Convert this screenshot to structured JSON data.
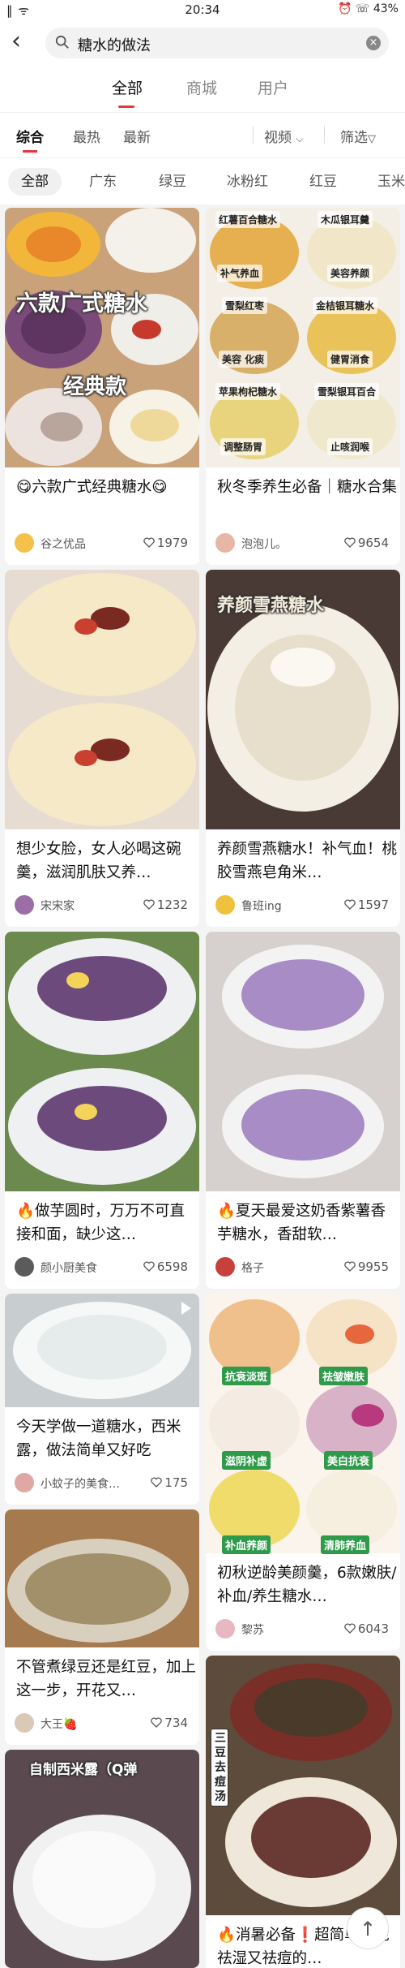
{
  "status": {
    "signal": "‖ ᯤ",
    "time": "20:34",
    "right": "⏰ ☏ 43%"
  },
  "search": {
    "query": "糖水的做法"
  },
  "tabs": [
    {
      "label": "全部"
    },
    {
      "label": "商城"
    },
    {
      "label": "用户"
    }
  ],
  "sort": {
    "items": [
      {
        "label": "综合"
      },
      {
        "label": "最热"
      },
      {
        "label": "最新"
      }
    ],
    "video": "视频",
    "filter": "筛选"
  },
  "chips": [
    {
      "label": "全部"
    },
    {
      "label": "广东"
    },
    {
      "label": "绿豆"
    },
    {
      "label": "冰粉红"
    },
    {
      "label": "红豆"
    },
    {
      "label": "玉米"
    }
  ],
  "cards": [
    {
      "title": "😋六款广式经典糖水😋",
      "author": "谷之优品",
      "likes": "1979",
      "overlay": [
        "六款广式糖水",
        "经典款"
      ]
    },
    {
      "title": "秋冬季养生必备｜糖水合集",
      "author": "泡泡儿。",
      "likes": "9654",
      "overlay": [
        "红薯百合糖水",
        "木瓜银耳羹",
        "补气养血",
        "美容养颜",
        "雪梨红枣",
        "金桔银耳糖水",
        "美容 化痰",
        "健胃消食",
        "苹果枸杞糖水",
        "雪梨银耳百合",
        "调整肠胃",
        "止咳润喉"
      ]
    },
    {
      "title": "想少女脸，女人必喝这碗羹，滋润肌肤又养…",
      "author": "宋宋家",
      "likes": "1232",
      "overlay": []
    },
    {
      "title": "养颜雪燕糖水！补气血！桃胶雪燕皂角米…",
      "author": "鲁班ing",
      "likes": "1597",
      "overlay": [
        "养颜雪燕糖水"
      ]
    },
    {
      "title": "🔥做芋圆时，万万不可直接和面，缺少这…",
      "author": "颜小厨美食",
      "likes": "6598",
      "overlay": []
    },
    {
      "title": "🔥夏天最爱这奶香紫薯香芋糖水，香甜软…",
      "author": "格子",
      "likes": "9955",
      "overlay": []
    },
    {
      "title": "今天学做一道糖水，西米露，做法简单又好吃",
      "author": "小蚊子的美食…",
      "likes": "175",
      "overlay": []
    },
    {
      "title": "初秋逆龄美颜羹，6款嫩肤/补血/养生糖水…",
      "author": "黎苏",
      "likes": "6043",
      "overlay": [
        "抗衰淡斑",
        "祛皱嫩肤",
        "滋阴补虚",
        "美白抗衰",
        "补血养颜",
        "清肺养血"
      ]
    },
    {
      "title": "不管煮绿豆还是红豆，加上这一步，开花又…",
      "author": "大王🍓",
      "likes": "734",
      "overlay": []
    },
    {
      "title": "🔥消暑必备❗️超简单，能祛湿又祛痘的…",
      "author": "",
      "likes": "",
      "overlay": [
        "三豆去痘汤"
      ]
    },
    {
      "title": "",
      "author": "",
      "likes": "",
      "overlay": [
        "自制西米露（Q弹"
      ]
    }
  ],
  "fab": "↑"
}
